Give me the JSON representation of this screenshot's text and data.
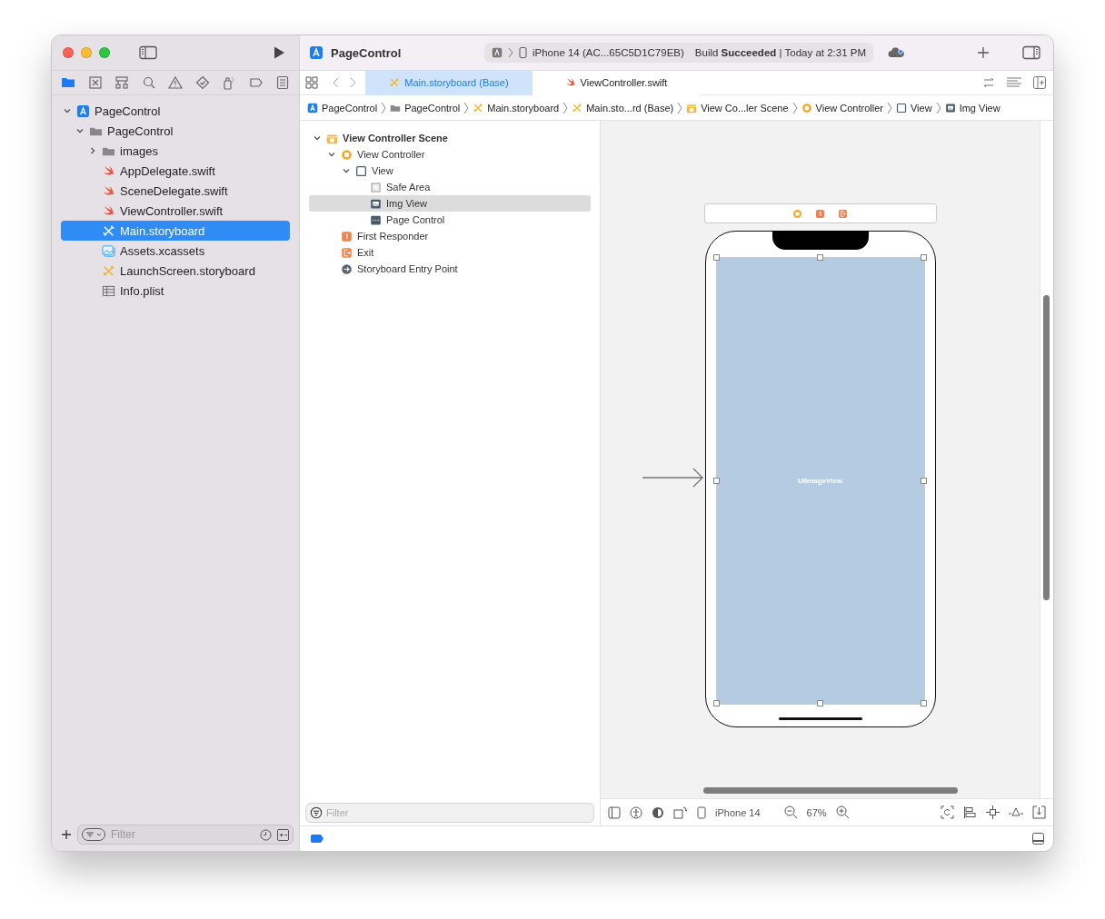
{
  "toolbar": {
    "project": "PageControl",
    "scheme_device": "iPhone 14 (AC...65C5D1C79EB)",
    "build_status": "Build **Succeeded** | Today at 2:31 PM"
  },
  "navigator_tabs": [
    {
      "kind": "folder",
      "selected": true
    },
    {
      "kind": "source",
      "selected": false
    },
    {
      "kind": "hierarchy",
      "selected": false
    },
    {
      "kind": "search",
      "selected": false
    },
    {
      "kind": "warning",
      "selected": false
    },
    {
      "kind": "test",
      "selected": false
    },
    {
      "kind": "debug",
      "selected": false
    },
    {
      "kind": "breakpoint",
      "selected": false
    },
    {
      "kind": "report",
      "selected": false
    }
  ],
  "file_tree": [
    {
      "label": "PageControl",
      "kind": "project",
      "expanded": true,
      "selected": false,
      "children": [
        {
          "label": "PageControl",
          "kind": "folder",
          "expanded": true,
          "selected": false,
          "children": [
            {
              "label": "images",
              "kind": "folder",
              "expanded": false,
              "selected": false
            },
            {
              "label": "AppDelegate.swift",
              "kind": "swift",
              "selected": false
            },
            {
              "label": "SceneDelegate.swift",
              "kind": "swift",
              "selected": false
            },
            {
              "label": "ViewController.swift",
              "kind": "swift",
              "selected": false
            },
            {
              "label": "Main.storyboard",
              "kind": "storyboard",
              "selected": true
            },
            {
              "label": "Assets.xcassets",
              "kind": "assets",
              "selected": false
            },
            {
              "label": "LaunchScreen.storyboard",
              "kind": "storyboard",
              "selected": false
            },
            {
              "label": "Info.plist",
              "kind": "plist",
              "selected": false
            }
          ]
        }
      ]
    }
  ],
  "navigator_filter": {
    "placeholder": "Filter"
  },
  "editor_tabs": [
    {
      "label": "Main.storyboard (Base)",
      "kind": "storyboard",
      "selected": true
    },
    {
      "label": "ViewController.swift",
      "kind": "swift",
      "selected": false
    }
  ],
  "breadcrumb": [
    {
      "label": "PageControl",
      "kind": "project"
    },
    {
      "label": "PageControl",
      "kind": "folder"
    },
    {
      "label": "Main.storyboard",
      "kind": "storyboard"
    },
    {
      "label": "Main.sto...rd (Base)",
      "kind": "storyboard"
    },
    {
      "label": "View Co...ler Scene",
      "kind": "scene"
    },
    {
      "label": "View Controller",
      "kind": "controller"
    },
    {
      "label": "View",
      "kind": "view"
    },
    {
      "label": "Img View",
      "kind": "imageview"
    }
  ],
  "outline": [
    {
      "label": "View Controller Scene",
      "kind": "scene",
      "expanded": true,
      "selected": false,
      "children": [
        {
          "label": "View Controller",
          "kind": "controller",
          "expanded": true,
          "selected": false,
          "children": [
            {
              "label": "View",
              "kind": "view",
              "expanded": true,
              "selected": false,
              "children": [
                {
                  "label": "Safe Area",
                  "kind": "safearea",
                  "selected": false
                },
                {
                  "label": "Img View",
                  "kind": "imageview",
                  "selected": true
                },
                {
                  "label": "Page Control",
                  "kind": "pagecontrol",
                  "selected": false
                }
              ]
            }
          ]
        },
        {
          "label": "First Responder",
          "kind": "responder",
          "selected": false
        },
        {
          "label": "Exit",
          "kind": "exit",
          "selected": false
        },
        {
          "label": "Storyboard Entry Point",
          "kind": "entry",
          "selected": false
        }
      ]
    }
  ],
  "outline_filter": {
    "placeholder": "Filter"
  },
  "canvas": {
    "image_view_label": "UIImageView"
  },
  "canvas_bar": {
    "device": "iPhone 14",
    "zoom": "67%"
  }
}
